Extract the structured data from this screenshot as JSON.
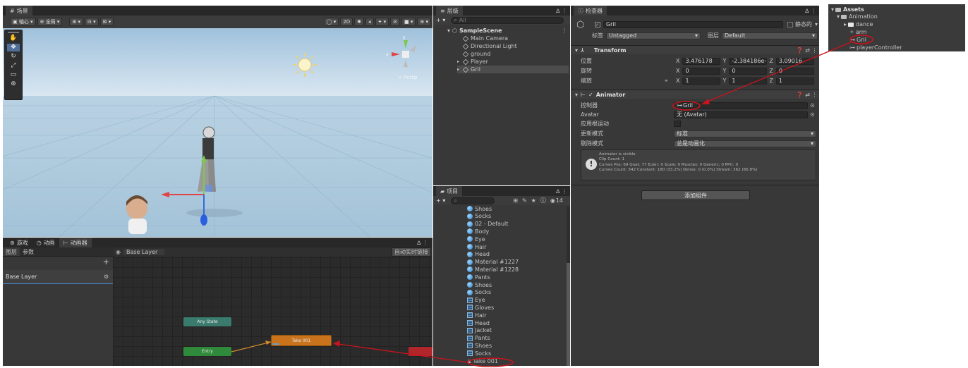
{
  "scene": {
    "tab": "场景",
    "pivot": "轴心",
    "global": "全局",
    "mode2d": "2D",
    "persp": "< Persp"
  },
  "game_tabs": [
    {
      "label": "游戏",
      "icon": "game-icon"
    },
    {
      "label": "动画",
      "icon": "animation-icon"
    },
    {
      "label": "动画器",
      "icon": "animator-icon"
    }
  ],
  "animator": {
    "layers_tab": "图层",
    "params_tab": "参数",
    "breadcrumb": "Base Layer",
    "live_link": "自动实时链接",
    "layer_name": "Base Layer",
    "nodes": {
      "any_state": "Any State",
      "take": "Take 001",
      "entry": "Entry"
    }
  },
  "hierarchy": {
    "tab": "层级",
    "search": "All",
    "scene": "SampleScene",
    "items": [
      {
        "label": "Main Camera",
        "expandable": false
      },
      {
        "label": "Directional Light",
        "expandable": false
      },
      {
        "label": "ground",
        "expandable": false
      },
      {
        "label": "Player",
        "expandable": true
      },
      {
        "label": "Gril",
        "expandable": true,
        "selected": true
      }
    ]
  },
  "project": {
    "tab": "项目",
    "count": "14",
    "items": [
      {
        "label": "Shoes",
        "type": "mat"
      },
      {
        "label": "Socks",
        "type": "mat"
      },
      {
        "label": "02 - Default",
        "type": "mat"
      },
      {
        "label": "Body",
        "type": "mat"
      },
      {
        "label": "Eye",
        "type": "mat"
      },
      {
        "label": "Hair",
        "type": "mat"
      },
      {
        "label": "Head",
        "type": "mat"
      },
      {
        "label": "Material #1227",
        "type": "mat"
      },
      {
        "label": "Material #1228",
        "type": "mat"
      },
      {
        "label": "Pants",
        "type": "mat"
      },
      {
        "label": "Shoes",
        "type": "mat"
      },
      {
        "label": "Socks",
        "type": "mat"
      },
      {
        "label": "Eye",
        "type": "tex"
      },
      {
        "label": "Gloves",
        "type": "tex"
      },
      {
        "label": "Hair",
        "type": "tex"
      },
      {
        "label": "Head",
        "type": "tex"
      },
      {
        "label": "Jacket",
        "type": "tex"
      },
      {
        "label": "Pants",
        "type": "tex"
      },
      {
        "label": "Shoes",
        "type": "tex"
      },
      {
        "label": "Socks",
        "type": "tex"
      },
      {
        "label": "Take 001",
        "type": "anim"
      }
    ]
  },
  "inspector": {
    "tab": "检查器",
    "object_name": "Gril",
    "static_label": "静态的",
    "tag_label": "标签",
    "tag_value": "Untagged",
    "layer_label": "图层",
    "layer_value": "Default",
    "transform": {
      "title": "Transform",
      "rows": [
        {
          "label": "位置",
          "x": "3.476178",
          "y": "-2.384186e-0",
          "z": "3.09016"
        },
        {
          "label": "旋转",
          "x": "0",
          "y": "0",
          "z": "0"
        },
        {
          "label": "缩放",
          "x": "1",
          "y": "1",
          "z": "1"
        }
      ]
    },
    "animator": {
      "title": "Animator",
      "controller_label": "控制器",
      "controller_value": "Gril",
      "avatar_label": "Avatar",
      "avatar_value": "无 (Avatar)",
      "root_motion_label": "应用根运动",
      "update_label": "更新模式",
      "update_value": "标准",
      "culling_label": "剔除模式",
      "culling_value": "总是动画化",
      "info": [
        "Animator is visible",
        "Clip Count: 1",
        "Curves Pos: 69 Quat: 77 Euler: 0 Scale: 9 Muscles: 0 Generic: 0 PPtr: 0",
        "Curves Count: 542 Constant: 180 (33.2%) Dense: 0 (0.0%) Stream: 362 (66.8%)"
      ]
    },
    "add_component": "添加组件"
  },
  "assets": {
    "root": "Assets",
    "animation": "Animation",
    "items": [
      "dance",
      "arm",
      "Gril",
      "playerController"
    ]
  },
  "colors": {
    "annotation": "#c8141e"
  }
}
